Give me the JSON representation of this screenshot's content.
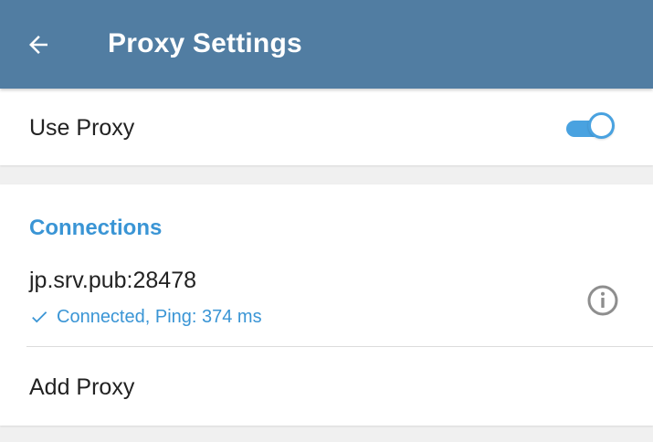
{
  "header": {
    "title": "Proxy Settings",
    "back_icon": "arrow-left-icon",
    "background_color": "#517da2"
  },
  "use_proxy": {
    "label": "Use Proxy",
    "enabled": true,
    "accent_color": "#49a2e0"
  },
  "connections": {
    "title": "Connections",
    "items": [
      {
        "address": "jp.srv.pub:28478",
        "status": "Connected, Ping: 374 ms",
        "status_icon": "check-icon",
        "info_icon": "info-icon"
      }
    ],
    "add_label": "Add Proxy"
  },
  "colors": {
    "accent": "#3a95d5",
    "page_background": "#f0f0f0"
  }
}
